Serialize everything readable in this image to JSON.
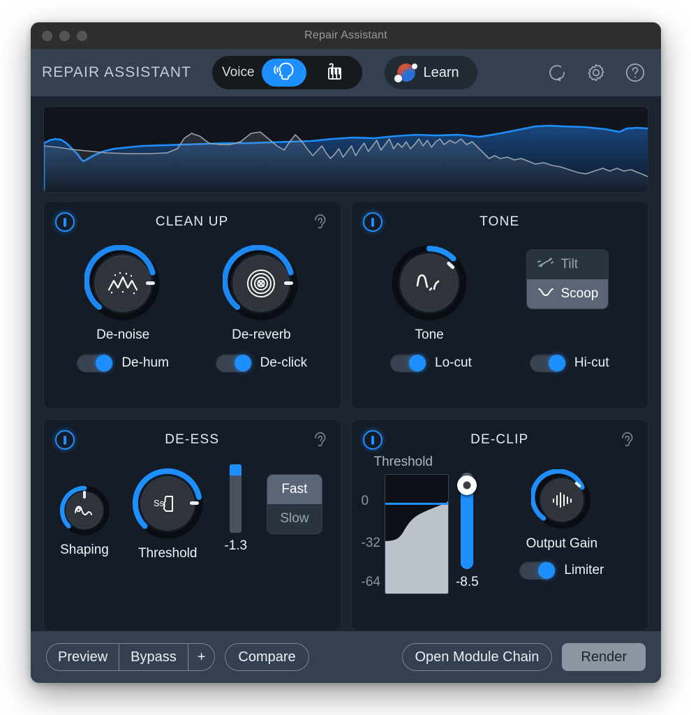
{
  "window": {
    "title": "Repair Assistant",
    "traffic_lights": [
      "close",
      "minimize",
      "zoom"
    ]
  },
  "header": {
    "brand": "REPAIR ASSISTANT",
    "source_toggle": {
      "label": "Voice",
      "options": [
        {
          "id": "voice",
          "icon": "speaking-head-icon",
          "selected": true
        },
        {
          "id": "music",
          "icon": "piano-icon",
          "selected": false
        }
      ]
    },
    "learn_button": {
      "label": "Learn",
      "icon": "assistant-orb-icon"
    },
    "icons": [
      {
        "name": "reset-icon"
      },
      {
        "name": "gear-icon"
      },
      {
        "name": "help-icon"
      }
    ]
  },
  "spectrum": {
    "name": "spectrum-display",
    "curve_color": "#1e8fff",
    "input_color": "#9aa3ad"
  },
  "modules": [
    {
      "id": "clean-up",
      "title": "CLEAN UP",
      "power": true,
      "solo_icon": "ear-icon",
      "knobs": [
        {
          "id": "de-noise",
          "label": "De-noise",
          "icon": "noise-peaks-icon",
          "arc_pct": 82
        },
        {
          "id": "de-reverb",
          "label": "De-reverb",
          "icon": "reverb-target-icon",
          "arc_pct": 82
        }
      ],
      "switches": [
        {
          "id": "de-hum",
          "label": "De-hum",
          "on": true
        },
        {
          "id": "de-click",
          "label": "De-click",
          "on": true
        }
      ]
    },
    {
      "id": "tone",
      "title": "TONE",
      "power": true,
      "solo_icon": null,
      "knobs": [
        {
          "id": "tone",
          "label": "Tone",
          "icon": "tone-curve-icon",
          "arc_pct": 22
        }
      ],
      "choices": [
        {
          "id": "tilt",
          "label": "Tilt",
          "icon": "tilt-icon",
          "selected": false
        },
        {
          "id": "scoop",
          "label": "Scoop",
          "icon": "scoop-icon",
          "selected": true
        }
      ],
      "switches": [
        {
          "id": "lo-cut",
          "label": "Lo-cut",
          "on": true
        },
        {
          "id": "hi-cut",
          "label": "Hi-cut",
          "on": true
        }
      ]
    },
    {
      "id": "de-ess",
      "title": "DE-ESS",
      "power": true,
      "solo_icon": "ear-icon",
      "knobs": [
        {
          "id": "shaping",
          "label": "Shaping",
          "icon": "sine-wave-icon",
          "arc_pct": 50
        },
        {
          "id": "threshold",
          "label": "Threshold",
          "icon": "ess-mouth-icon",
          "arc_pct": 84
        }
      ],
      "meter": {
        "id": "de-ess-meter",
        "value": "-1.3",
        "fill_pct": 16
      },
      "choices": [
        {
          "id": "fast",
          "label": "Fast",
          "selected": true
        },
        {
          "id": "slow",
          "label": "Slow",
          "selected": false
        }
      ]
    },
    {
      "id": "de-clip",
      "title": "DE-CLIP",
      "power": true,
      "solo_icon": "ear-icon",
      "threshold": {
        "label": "Threshold",
        "axis_labels": [
          "0",
          "-32",
          "-64"
        ],
        "value": "-8.5",
        "slider_pct": 88
      },
      "knobs": [
        {
          "id": "output-gain",
          "label": "Output Gain",
          "icon": "output-bars-icon",
          "arc_pct": 72
        }
      ],
      "switches": [
        {
          "id": "limiter",
          "label": "Limiter",
          "on": true
        }
      ]
    }
  ],
  "footer": {
    "preview": "Preview",
    "bypass": "Bypass",
    "plus": "+",
    "compare": "Compare",
    "open_module_chain": "Open Module Chain",
    "render": "Render"
  },
  "colors": {
    "accent": "#1e8fff",
    "panel": "#141c27",
    "window": "#1b2430",
    "bar": "#344050"
  }
}
